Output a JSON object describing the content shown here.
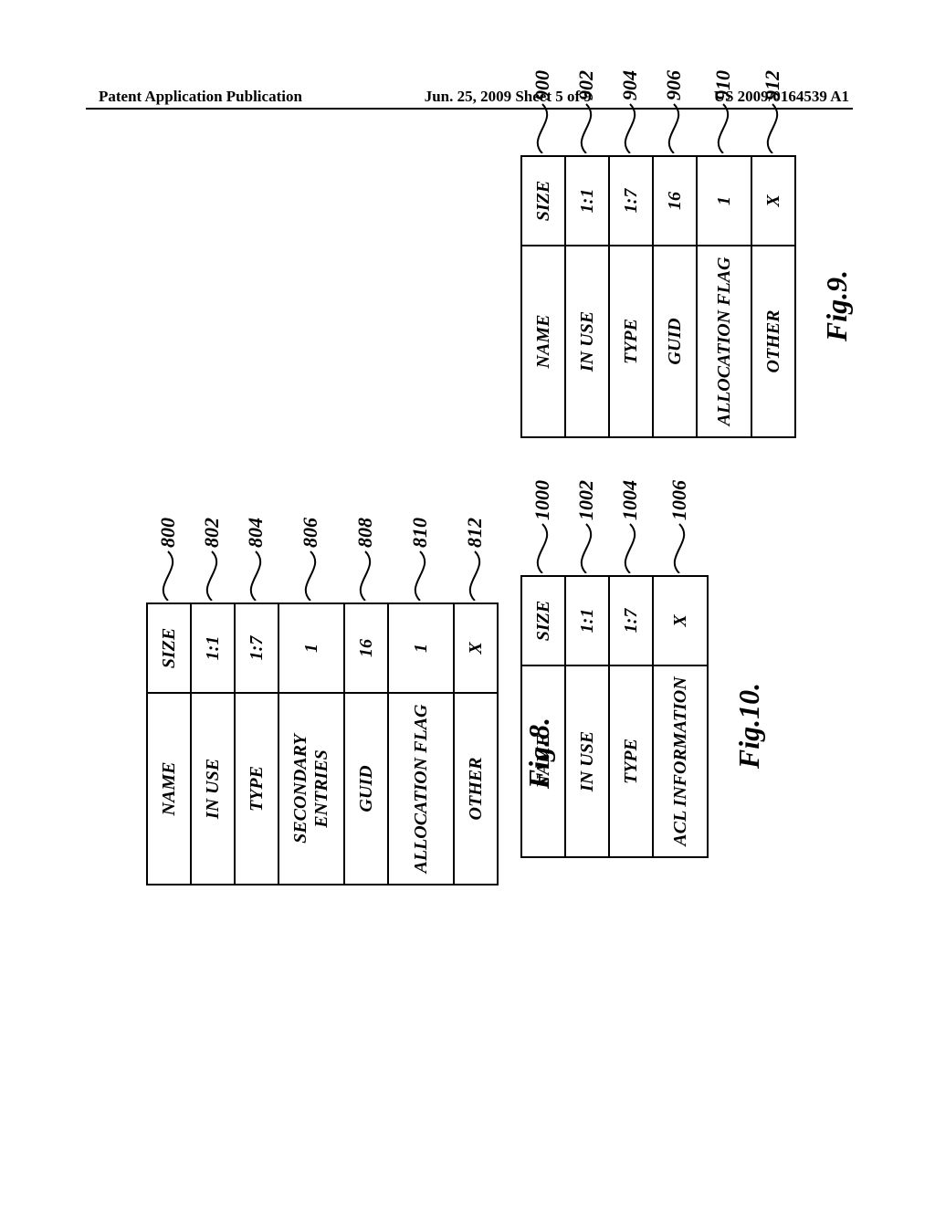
{
  "header": {
    "left": "Patent Application Publication",
    "center": "Jun. 25, 2009  Sheet 5 of 9",
    "right": "US 2009/0164539 A1"
  },
  "fig8": {
    "label": "Fig.8.",
    "header": {
      "name": "NAME",
      "size": "SIZE"
    },
    "rows": [
      {
        "name": "IN USE",
        "size": "1:1",
        "ref": "802"
      },
      {
        "name": "TYPE",
        "size": "1:7",
        "ref": "804"
      },
      {
        "name": "SECONDARY ENTRIES",
        "size": "1",
        "ref": "806"
      },
      {
        "name": "GUID",
        "size": "16",
        "ref": "808"
      },
      {
        "name": "ALLOCATION FLAG",
        "size": "1",
        "ref": "810"
      },
      {
        "name": "OTHER",
        "size": "X",
        "ref": "812"
      }
    ],
    "header_ref": "800"
  },
  "fig9": {
    "label": "Fig.9.",
    "header": {
      "name": "NAME",
      "size": "SIZE"
    },
    "rows": [
      {
        "name": "IN USE",
        "size": "1:1",
        "ref": "902"
      },
      {
        "name": "TYPE",
        "size": "1:7",
        "ref": "904"
      },
      {
        "name": "GUID",
        "size": "16",
        "ref": "906"
      },
      {
        "name": "ALLOCATION FLAG",
        "size": "1",
        "ref": "910"
      },
      {
        "name": "OTHER",
        "size": "X",
        "ref": "912"
      }
    ],
    "header_ref": "900"
  },
  "fig10": {
    "label": "Fig.10.",
    "header": {
      "name": "NAME",
      "size": "SIZE"
    },
    "rows": [
      {
        "name": "IN USE",
        "size": "1:1",
        "ref": "1002"
      },
      {
        "name": "TYPE",
        "size": "1:7",
        "ref": "1004"
      },
      {
        "name": "ACL INFORMATION",
        "size": "X",
        "ref": "1006"
      }
    ],
    "header_ref": "1000"
  }
}
